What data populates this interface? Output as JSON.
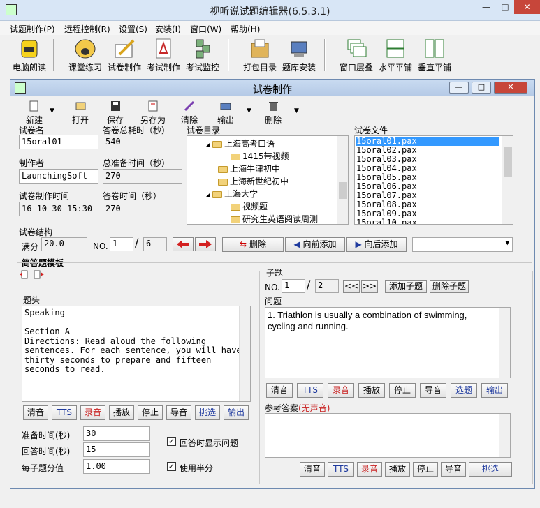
{
  "window": {
    "title": "视听说试题编辑器(6.5.3.1)",
    "minimize": "—",
    "maximize": "□",
    "close": "✕"
  },
  "menu": [
    "试题制作(P)",
    "远程控制(R)",
    "设置(S)",
    "安装(I)",
    "窗口(W)",
    "帮助(H)"
  ],
  "toolbar": [
    "电脑朗读",
    "课堂练习",
    "试卷制作",
    "考试制作",
    "考试监控",
    "打包目录",
    "题库安装",
    "窗口层叠",
    "水平平铺",
    "垂直平铺"
  ],
  "inner": {
    "title": "试卷制作",
    "toolbar": {
      "new": "新建",
      "open": "打开",
      "save": "保存",
      "saveas": "另存为",
      "clear": "清除",
      "export": "输出",
      "delete": "删除"
    },
    "labels": {
      "paper_name": "试卷名",
      "total_time": "答卷总耗时（秒）",
      "catalog": "试卷目录",
      "files": "试卷文件",
      "author": "制作者",
      "prep_time": "总准备时间（秒）",
      "created": "试卷制作时间",
      "answer_time": "答卷时间（秒）"
    },
    "values": {
      "paper_name": "15oral01",
      "total_time": "540",
      "author": "LaunchingSoft",
      "prep_time": "270",
      "created": "16-10-30 15:30",
      "answer_time": "270"
    },
    "catalog_items": [
      "上海高考口语",
      "1415带视频",
      "上海牛津初中",
      "上海新世纪初中",
      "上海大学",
      "视频题",
      "研究生英语阅读周测"
    ],
    "files": [
      "15oral01.pax",
      "15oral02.pax",
      "15oral03.pax",
      "15oral04.pax",
      "15oral05.pax",
      "15oral06.pax",
      "15oral07.pax",
      "15oral08.pax",
      "15oral09.pax",
      "15oral10.pax"
    ],
    "structure": {
      "label": "试卷结构",
      "full_label": "满分",
      "full_value": "20.0",
      "no_label": "NO.",
      "current": "1",
      "slash": "/",
      "total": "6",
      "delete": "删除",
      "add_before": "向前添加",
      "add_after": "向后添加"
    },
    "template": {
      "title": "简答题模板",
      "header_label": "题头",
      "header_text": "Speaking\n\nSection A\nDirections: Read aloud the following\nsentences. For each sentence, you will have\nthirty seconds to prepare and fifteen\nseconds to read.",
      "buttons": [
        "清音",
        "TTS",
        "录音",
        "播放",
        "停止",
        "导音",
        "挑选",
        "输出"
      ],
      "prep_label": "准备时间(秒)",
      "prep_value": "30",
      "answer_label": "回答时间(秒)",
      "answer_value": "15",
      "score_label": "每子题分值",
      "score_value": "1.00",
      "show_question": "回答时显示问题",
      "half_score": "使用半分"
    },
    "sub": {
      "title": "子题",
      "no_label": "NO.",
      "current": "1",
      "slash": "/",
      "total": "2",
      "prev": "<<",
      "next": ">>",
      "add": "添加子题",
      "delete": "删除子题",
      "question_label": "问题",
      "question_text": "1. Triathlon is usually a combination of swimming, cycling and running.",
      "buttons": [
        "清音",
        "TTS",
        "录音",
        "播放",
        "停止",
        "导音",
        "选题",
        "输出"
      ],
      "answer_label": "参考答案",
      "answer_note": "(无声音)",
      "answer_buttons": [
        "清音",
        "TTS",
        "录音",
        "播放",
        "停止",
        "导音",
        "挑选"
      ]
    }
  },
  "colors": {
    "blue_btn": "#1f3a9e",
    "red_btn": "#c81e1e",
    "selection": "#3399ff"
  }
}
